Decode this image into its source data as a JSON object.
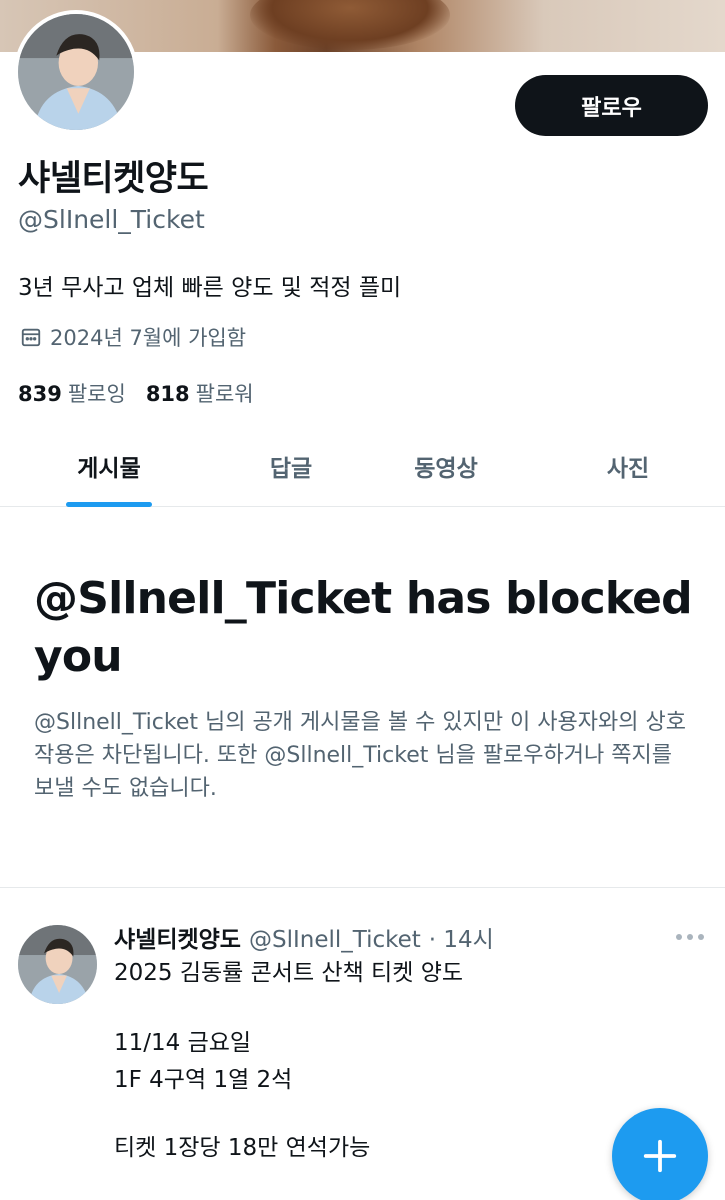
{
  "profile": {
    "display_name": "샤넬티켓양도",
    "handle": "@SlInell_Ticket",
    "bio": "3년 무사고 업체 빠른 양도 및 적정 플미",
    "joined": "2024년 7월에 가입함",
    "following_count": "839",
    "following_label": "팔로잉",
    "followers_count": "818",
    "followers_label": "팔로워",
    "follow_button_label": "팔로우"
  },
  "tabs": [
    {
      "label": "게시물",
      "active": true
    },
    {
      "label": "답글",
      "active": false
    },
    {
      "label": "동영상",
      "active": false
    },
    {
      "label": "사진",
      "active": false
    }
  ],
  "blocked": {
    "title": "@Sllnell_Ticket has blocked you",
    "description": "@Sllnell_Ticket 님의 공개 게시물을 볼 수 있지만 이 사용자와의 상호작용은 차단됩니다. 또한 @Sllnell_Ticket 님을 팔로우하거나 쪽지를 보낼 수도 없습니다."
  },
  "tweet": {
    "name": "샤넬티켓양도",
    "handle": "@SlInell_Ticket",
    "time": "· 14시",
    "lines": [
      "2025 김동률 콘서트 산책 티켓 양도",
      "11/14 금요일",
      "1F 4구역 1열 2석",
      "티켓 1장당 18만 연석가능"
    ]
  },
  "icons": {
    "calendar": "calendar-icon",
    "more": "more-icon",
    "compose": "plus-icon"
  },
  "colors": {
    "accent": "#1d9bf0",
    "text": "#0f1419",
    "secondary": "#536471"
  }
}
